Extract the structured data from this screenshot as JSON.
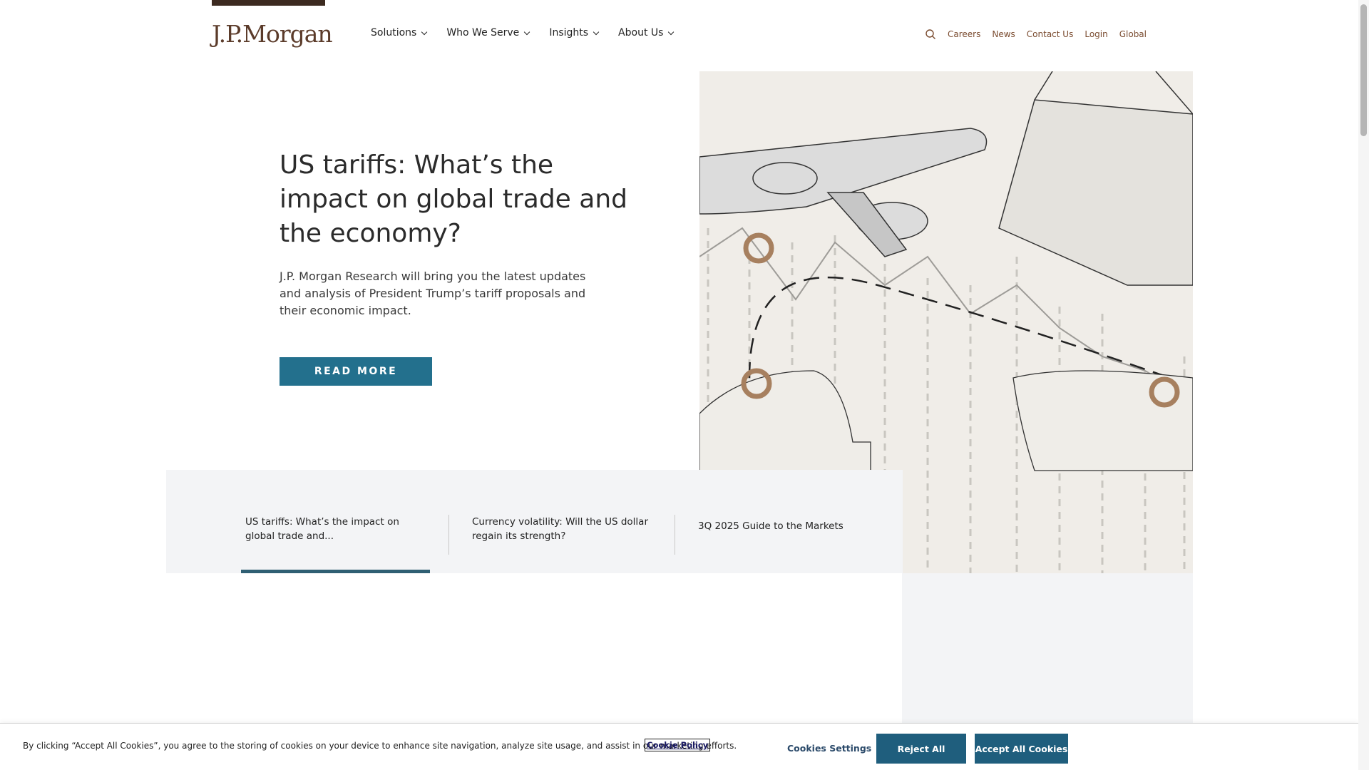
{
  "header": {
    "logo": "J.P.Morgan",
    "nav": [
      {
        "label": "Solutions"
      },
      {
        "label": "Who We Serve"
      },
      {
        "label": "Insights"
      },
      {
        "label": "About Us"
      }
    ],
    "utility": {
      "search_icon": "search-icon",
      "links": [
        "Careers",
        "News",
        "Contact Us",
        "Login",
        "Global"
      ]
    }
  },
  "hero": {
    "title": "US tariffs: What’s the impact on global trade and the economy?",
    "description": "J.P. Morgan Research will bring you the latest updates and analysis of President Trump’s tariff proposals and their economic impact.",
    "button_label": "READ MORE"
  },
  "carousel": {
    "items": [
      {
        "label": "US tariffs: What’s the impact on global trade and..."
      },
      {
        "label": "Currency volatility: Will the US dollar regain its strength?"
      },
      {
        "label": "3Q 2025 Guide to the Markets"
      }
    ],
    "active_index": 0
  },
  "cookie_banner": {
    "text": "By clicking “Accept All Cookies”, you agree to the storing of cookies on your device to enhance site navigation, analyze site usage, and assist in our marketing efforts.",
    "policy_link": "Cookie Policy",
    "settings_label": "Cookies Settings",
    "reject_label": "Reject All",
    "accept_label": "Accept All Cookies"
  },
  "colors": {
    "brand": "#5b3b2a",
    "accent": "#23708d",
    "util_link": "#7a4b2f"
  }
}
